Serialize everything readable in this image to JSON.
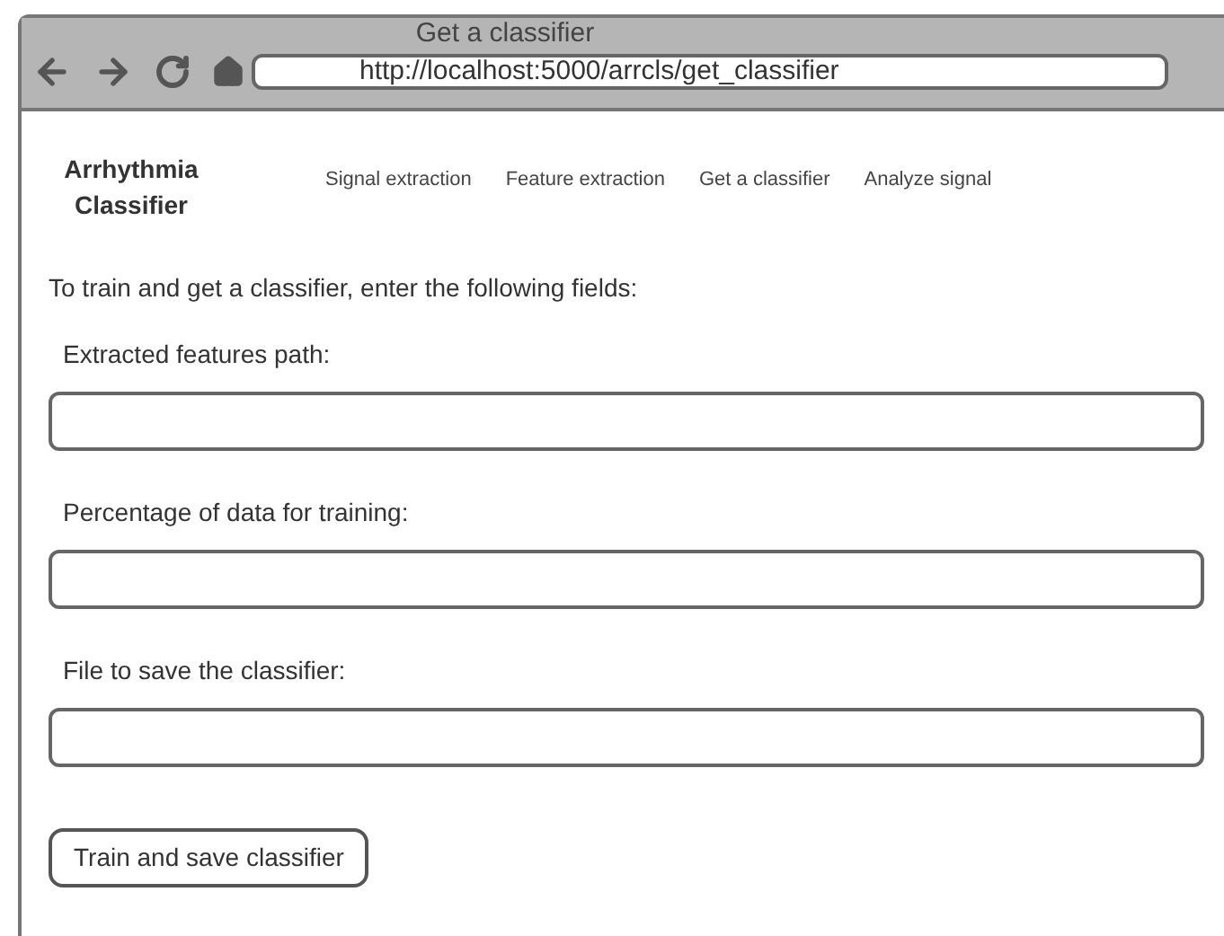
{
  "window": {
    "title": "Get a classifier",
    "url": "http://localhost:5000/arrcls/get_classifier"
  },
  "brand": [
    "Arrhythmia",
    "Classifier"
  ],
  "nav": [
    {
      "label": "Signal extraction"
    },
    {
      "label": "Feature extraction"
    },
    {
      "label": "Get a classifier"
    },
    {
      "label": "Analyze signal"
    }
  ],
  "intro": "To train and get a classifier, enter the following fields:",
  "fields": [
    {
      "label": "Extracted features path:"
    },
    {
      "label": "Percentage of data for training:"
    },
    {
      "label": "File to save the classifier:"
    }
  ],
  "button": "Train and save classifier"
}
